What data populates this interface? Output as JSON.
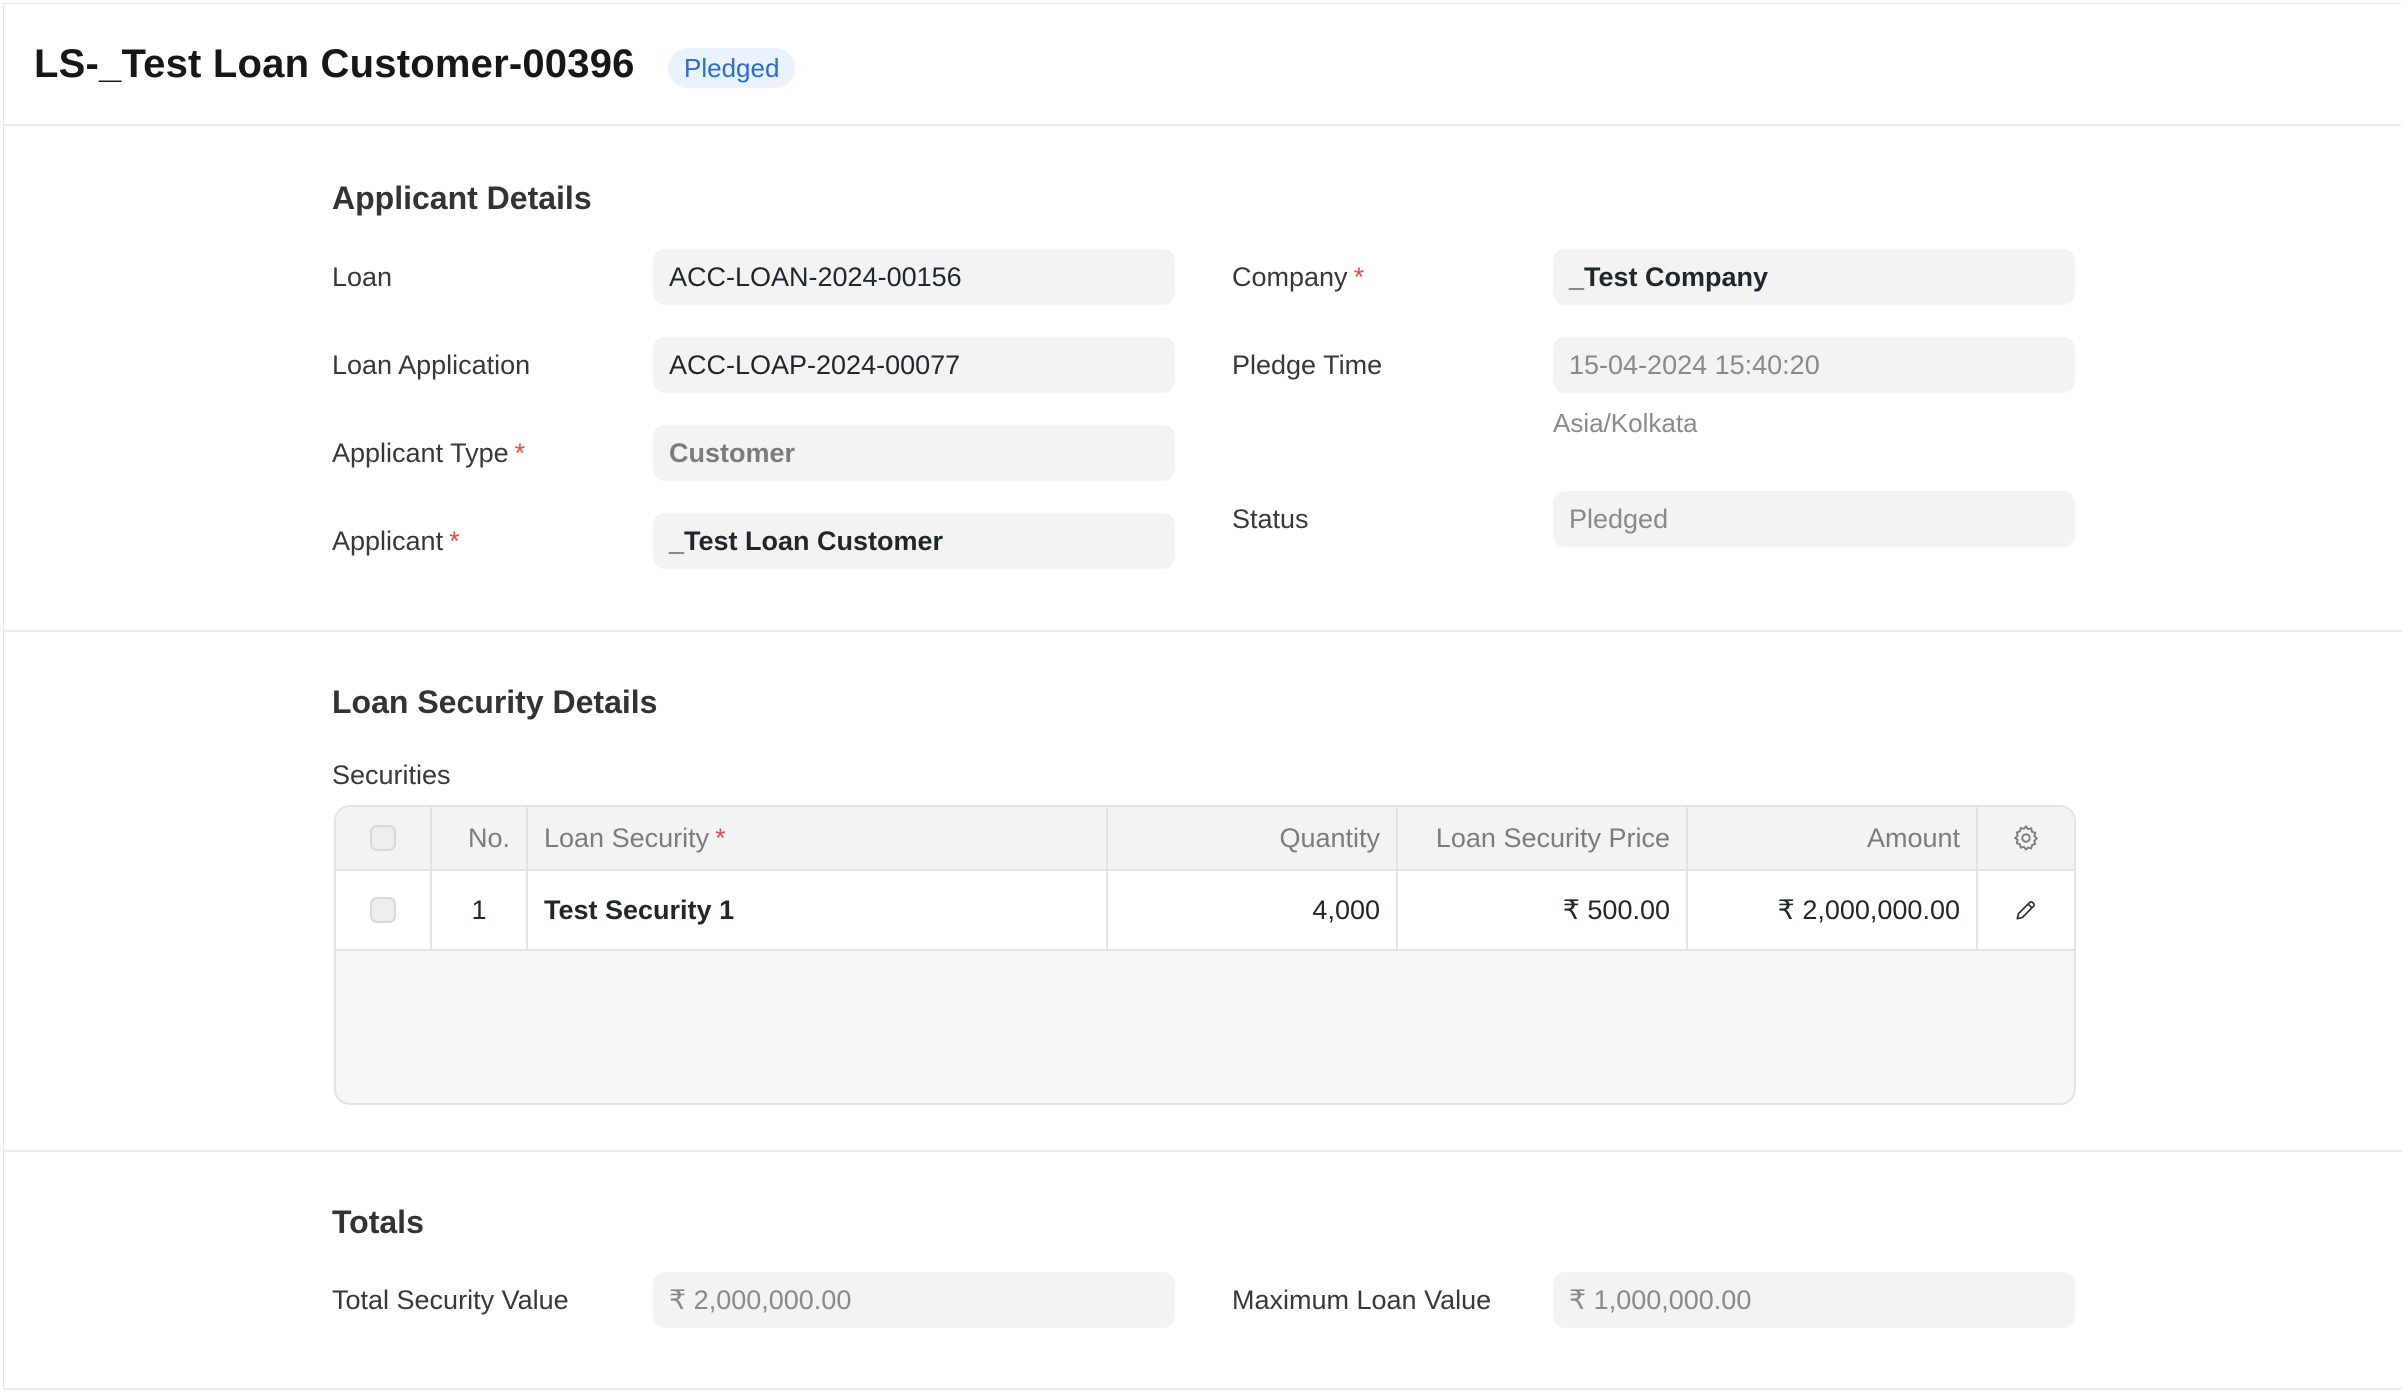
{
  "header": {
    "title": "LS-_Test Loan Customer-00396",
    "status": "Pledged"
  },
  "applicant_details": {
    "title": "Applicant Details",
    "loan": {
      "label": "Loan",
      "value": "ACC-LOAN-2024-00156"
    },
    "loan_application": {
      "label": "Loan Application",
      "value": "ACC-LOAP-2024-00077"
    },
    "applicant_type": {
      "label": "Applicant Type",
      "value": "Customer",
      "required": "*"
    },
    "applicant": {
      "label": "Applicant",
      "value": "_Test Loan Customer",
      "required": "*"
    },
    "company": {
      "label": "Company",
      "value": "_Test Company",
      "required": "*"
    },
    "pledge_time": {
      "label": "Pledge Time",
      "value": "15-04-2024 15:40:20",
      "timezone": "Asia/Kolkata"
    },
    "status": {
      "label": "Status",
      "value": "Pledged"
    }
  },
  "loan_security_details": {
    "title": "Loan Security Details",
    "table_label": "Securities",
    "columns": {
      "no": "No.",
      "loan_security": "Loan Security",
      "loan_security_required": "*",
      "quantity": "Quantity",
      "price": "Loan Security Price",
      "amount": "Amount"
    },
    "rows": [
      {
        "no": "1",
        "loan_security": "Test Security 1",
        "quantity": "4,000",
        "price": "₹ 500.00",
        "amount": "₹ 2,000,000.00"
      }
    ],
    "icons": {
      "settings": "gear-icon",
      "edit": "pencil-icon"
    }
  },
  "totals": {
    "title": "Totals",
    "total_security_value": {
      "label": "Total Security Value",
      "value": "₹ 2,000,000.00"
    },
    "maximum_loan_value": {
      "label": "Maximum Loan Value",
      "value": "₹ 1,000,000.00"
    }
  },
  "colors": {
    "status_pill_bg": "#eaf3fd",
    "status_pill_text": "#2a6cd1",
    "required_marker": "#e24c4c"
  }
}
